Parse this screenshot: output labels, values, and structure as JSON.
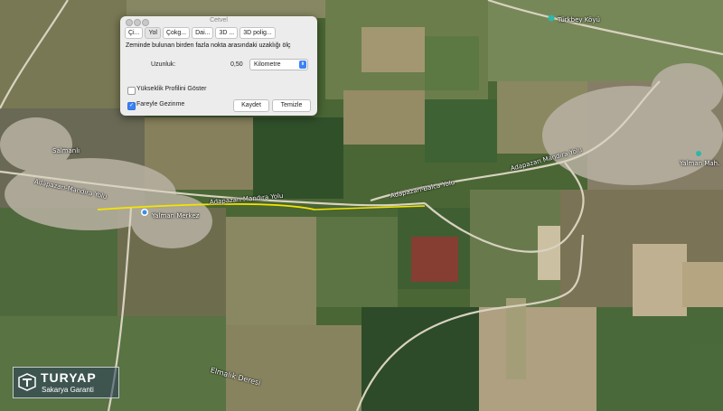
{
  "dialog": {
    "title": "Cetvel",
    "tabs": [
      "Çi...",
      "Yol",
      "Çokg...",
      "Dai...",
      "3D ...",
      "3D polig..."
    ],
    "active_tab": 1,
    "description": "Zeminde bulunan birden fazla nokta arasındaki uzaklığı ölç",
    "length_label": "Uzunluk:",
    "length_value": "0,50",
    "unit": "Kilometre",
    "elevation_profile_label": "Yükseklik Profilini Göster",
    "elevation_profile_checked": false,
    "mouse_navigation_label": "Fareyle Gezinme",
    "mouse_navigation_checked": true,
    "save_label": "Kaydet",
    "clear_label": "Temizle"
  },
  "map": {
    "labels": {
      "salmanli": "Salmanlı",
      "yalman_merkez": "Yalman Merkez",
      "road_left": "Adapazarı-Mandıra Yolu",
      "road_mid": "Adapazarı Mandıra Yolu",
      "road_right": "Adapazarı-Balca Yolu",
      "road_far": "Adapazarı Mandıra Yolu",
      "village_right": "Yalman Mah.",
      "stream": "Elmalık Deresi",
      "top_right": "Türkbey Köyü"
    },
    "measured_line_color": "#f5e400"
  },
  "logo": {
    "name": "TURYAP",
    "subtitle": "Sakarya Garanti"
  }
}
